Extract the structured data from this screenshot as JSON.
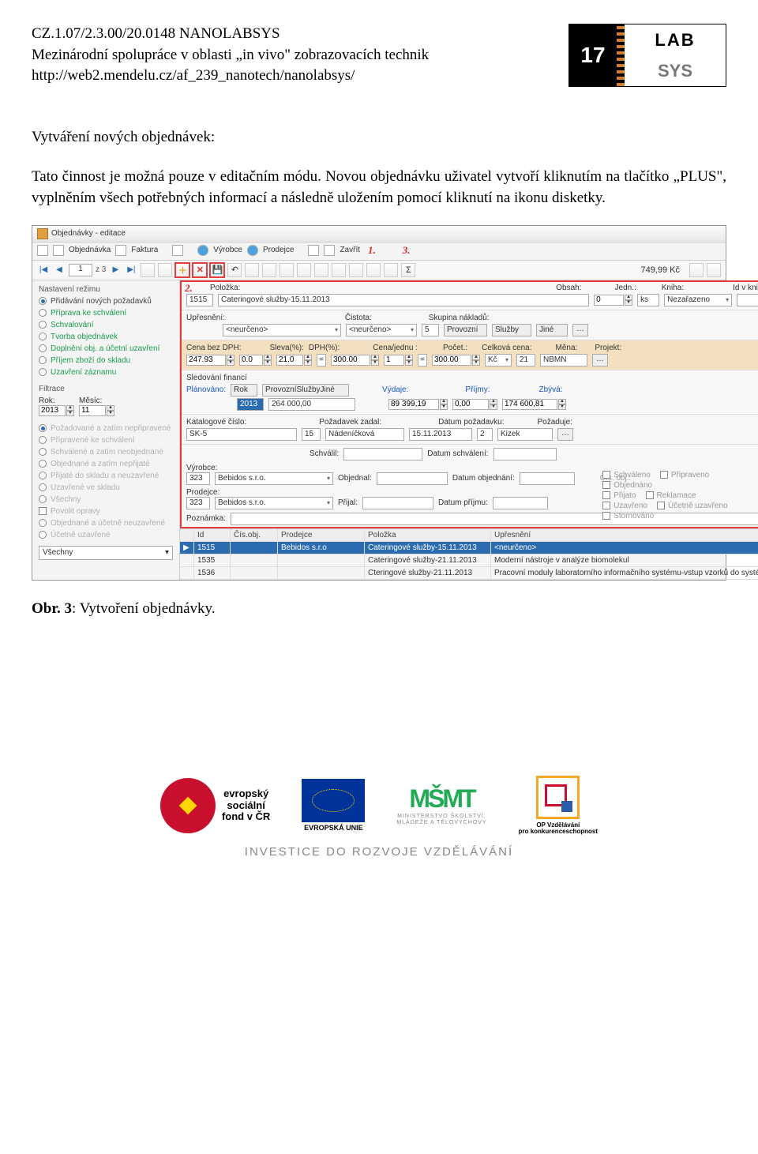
{
  "doc": {
    "code": "CZ.1.07/2.3.00/20.0148 NANOLABSYS",
    "subtitle": "Mezinárodní spolupráce v oblasti „in vivo\" zobrazovacích technik",
    "url": "http://web2.mendelu.cz/af_239_nanotech/nanolabsys/",
    "section_title": "Vytváření nových objednávek:",
    "paragraph": "Tato činnost je možná pouze v editačním módu. Novou objednávku uživatel vytvoří kliknutím na tlačítko „PLUS\", vyplněním všech potřebných informací a následně uložením pomocí kliknutí na ikonu disketky.",
    "caption_prefix": "Obr. 3",
    "caption_rest": ": Vytvoření objednávky."
  },
  "logo": {
    "left": "17",
    "top": "LAB",
    "bot": "SYS"
  },
  "shot": {
    "title": "Objednávky - editace",
    "tabs": {
      "objednavka": "Objednávka",
      "faktura": "Faktura",
      "vyrobce": "Výrobce",
      "prodejce": "Prodejce",
      "zavrit": "Zavřít"
    },
    "nav": {
      "page": "1",
      "of_prefix": "z",
      "of": "3",
      "total": "749,99 Kč"
    },
    "callouts": {
      "c1": "1.",
      "c2": "2.",
      "c3": "3."
    },
    "sidebar": {
      "heading": "Nastavení režimu",
      "modes": [
        "Přidávání nových požadavků",
        "Příprava ke schválení",
        "Schvalování",
        "Tvorba objednávek",
        "Doplnění obj. a účetní uzavření",
        "Příjem zboží do skladu",
        "Uzavření záznamu"
      ],
      "filter_heading": "Filtrace",
      "rok_label": "Rok:",
      "rok": "2013",
      "mesic_label": "Měsíc:",
      "mesic": "11",
      "states": [
        "Požadované a zatím nepřipravené",
        "Připravené ke schválení",
        "Schválené a zatím neobjednané",
        "Objednané a zatím nepřijaté",
        "Přijaté do skladu a neuzavřené",
        "Uzavřené ve skladu",
        "Všechny",
        "Povolit opravy",
        "Objednané a účetně neuzavřené",
        "Účetně uzavřené"
      ],
      "combo": "Všechny"
    },
    "form": {
      "row1": {
        "polozka_l": "Položka:",
        "polozka_id": "1515",
        "polozka": "Cateringové služby-15.11.2013",
        "obsah_l": "Obsah:",
        "obsah": "0",
        "jedn_l": "Jedn.:",
        "jedn": "ks",
        "kniha_l": "Kniha:",
        "kniha": "Nezařazeno",
        "idvk_l": "Id v knize:"
      },
      "row2": {
        "upresneni_l": "Upřesnění:",
        "upresneni": "<neurčeno>",
        "cistota_l": "Čistota:",
        "cistota": "<neurčeno>",
        "skupina_l": "Skupina nákladů:",
        "skupina_n": "5",
        "g1": "Provozní",
        "g2": "Služby",
        "g3": "Jiné"
      },
      "row3": {
        "cena_l": "Cena bez DPH:",
        "cena": "247.93",
        "sleva_l": "Sleva(%):",
        "sleva": "0.0",
        "dph_l": "DPH(%):",
        "dph": "21.0",
        "cenaj_l": "Cena/jednu :",
        "cenaj": "300.00",
        "pocet_l": "Počet.:",
        "pocet": "1",
        "celk_l": "Celková cena:",
        "celk": "300.00",
        "mena_l": "Měna:",
        "mena": "Kč",
        "proj_l": "Projekt:",
        "proj_n": "21",
        "proj": "NBMN"
      },
      "row4": {
        "heading": "Sledování financí",
        "plan_l": "Plánováno:",
        "rok_h": "Rok",
        "cat_h": "ProvozníSlužbyJiné",
        "rok": "2013",
        "val": "264 000,00",
        "vyd_l": "Výdaje:",
        "vyd": "89 399,19",
        "prij_l": "Příjmy:",
        "prij": "0,00",
        "zbyva_l": "Zbývá:",
        "zbyva": "174 600,81"
      },
      "row5": {
        "kat_l": "Katalogové číslo:",
        "kat": "SK-5",
        "pz_l": "Požadavek zadal:",
        "pz_n": "15",
        "pz": "Nádeníčková",
        "dp_l": "Datum požadavku:",
        "dp": "15.11.2013",
        "poz_l": "Požaduje:",
        "poz_n": "2",
        "poz": "Kizek"
      },
      "row6": {
        "sch_l": "Schválil:",
        "ds_l": "Datum schválení:",
        "vyr_l": "Výrobce:",
        "vyr_n": "323",
        "vyr": "Bebidos s.r.o.",
        "obj_l": "Objednal:",
        "do_l": "Datum objednání:",
        "co_l": "Čís. obj.:",
        "pro_l": "Prodejce:",
        "pro_n": "323",
        "pro": "Bebidos s.r.o.",
        "prij_l": "Přijal:",
        "dprij_l": "Datum příjmu:",
        "pozn_l": "Poznámka:"
      },
      "statuses": [
        "Schváleno",
        "Připraveno",
        "Objednáno",
        "Reklamace",
        "Přijato",
        "Uzavřeno",
        "Účetně uzavřeno",
        "Stornováno"
      ]
    },
    "grid": {
      "headers": [
        "Id",
        "Čís.obj.",
        "Prodejce",
        "Položka",
        "Upřesnění"
      ],
      "rows": [
        {
          "id": "1515",
          "cis": "",
          "prod": "Bebidos s.r.o",
          "pol": "Cateringové služby-15.11.2013",
          "up": "<neurčeno>"
        },
        {
          "id": "1535",
          "cis": "",
          "prod": "",
          "pol": "Cateringové služby-21.11.2013",
          "up": "Moderní nástroje v analýze biomolekul"
        },
        {
          "id": "1536",
          "cis": "",
          "prod": "",
          "pol": "Cteringové služby-21.11.2013",
          "up": "Pracovní moduly laboratorního informačního systému-vstup vzorků do systému"
        }
      ]
    }
  },
  "footer": {
    "esf1": "evropský",
    "esf2": "sociální",
    "esf3": "fond v ČR",
    "eu": "EVROPSKÁ UNIE",
    "msmt1": "MINISTERSTVO ŠKOLSTVÍ,",
    "msmt2": "MLÁDEŽE A TĚLOVÝCHOVY",
    "opvk1": "OP Vzdělávání",
    "opvk2": "pro konkurenceschopnost",
    "invest": "INVESTICE DO ROZVOJE VZDĚLÁVÁNÍ"
  }
}
